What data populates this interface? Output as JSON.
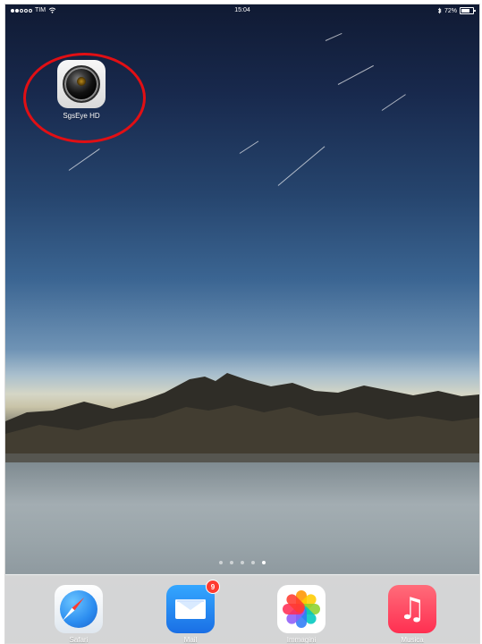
{
  "status_bar": {
    "carrier": "TIM",
    "time": "15:04",
    "battery_percent": "72%",
    "battery_level": 0.72
  },
  "home": {
    "apps": [
      {
        "name": "SgsEye HD",
        "icon": "sgseye-hd-icon",
        "highlighted": true
      }
    ]
  },
  "page_indicator": {
    "pages": 5,
    "current": 5
  },
  "dock": {
    "apps": [
      {
        "name": "Safari",
        "icon": "safari-icon"
      },
      {
        "name": "Mail",
        "icon": "mail-icon",
        "badge": "9"
      },
      {
        "name": "Immagini",
        "icon": "photos-icon"
      },
      {
        "name": "Musica",
        "icon": "music-icon"
      }
    ]
  },
  "colors": {
    "highlight": "#e10f14",
    "badge": "#ff3b30",
    "mail": "#1a6fe5",
    "music": "#ff2f51",
    "safari": "#2c8df0"
  }
}
